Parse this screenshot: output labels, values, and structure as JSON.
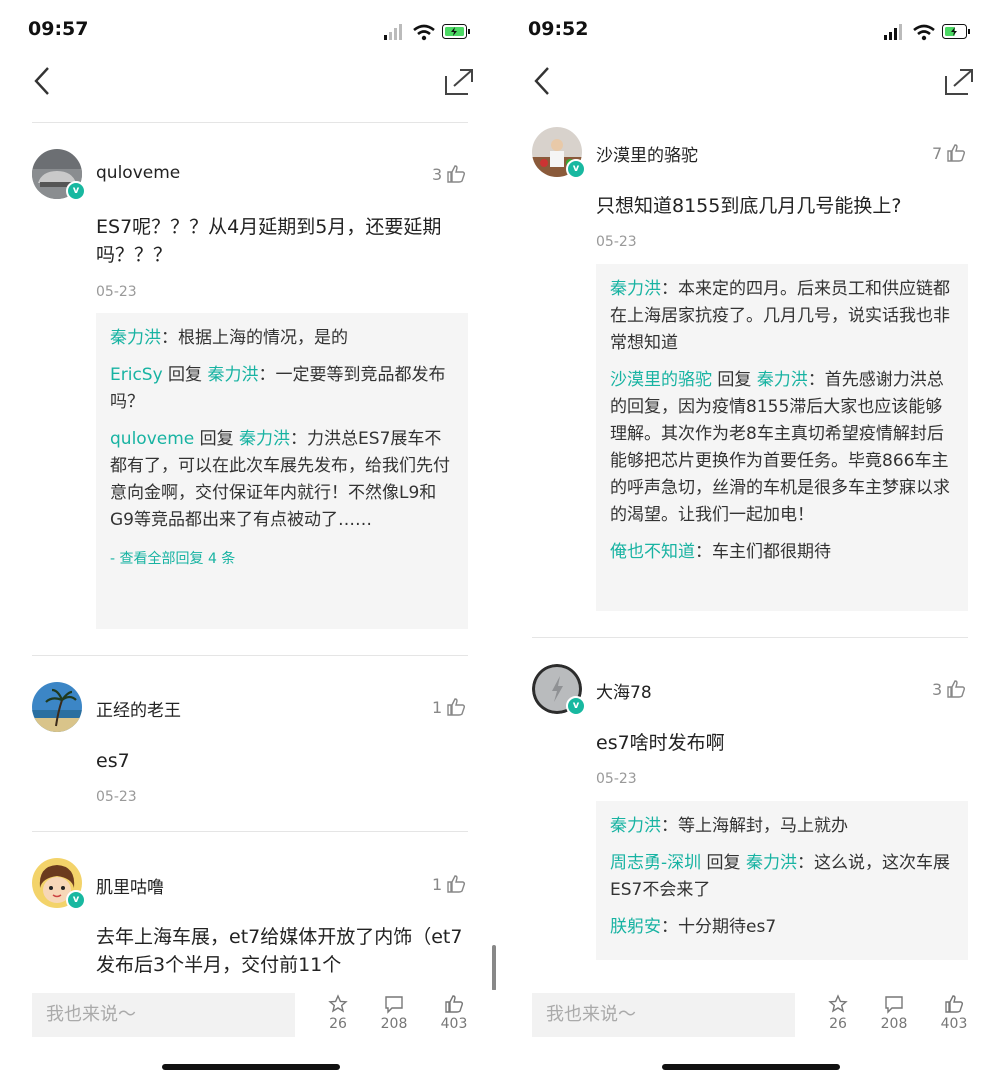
{
  "left": {
    "time": "09:57",
    "comments": [
      {
        "user": "quloveme",
        "likes": "3",
        "text": "ES7呢？？？从4月延期到5月，还要延期吗？？？",
        "date": "05-23",
        "replies": [
          {
            "name": "秦力洪",
            "reply_to": "",
            "text": "：根据上海的情况，是的"
          },
          {
            "name": "EricSy",
            "mid": " 回复 ",
            "reply_to": "秦力洪",
            "text": "：一定要等到竞品都发布吗？"
          },
          {
            "name": "quloveme",
            "mid": " 回复 ",
            "reply_to": "秦力洪",
            "text": "：力洪总ES7展车不都有了，可以在此次车展先发布，给我们先付意向金啊，交付保证年内就行！不然像L9和G9等竞品都出来了有点被动了……"
          }
        ],
        "more": "- 查看全部回复 4 条"
      },
      {
        "user": "正经的老王",
        "likes": "1",
        "text": "es7",
        "date": "05-23"
      },
      {
        "user": "肌里咕噜",
        "likes": "1",
        "text": "去年上海车展，et7给媒体开放了内饰（et7发布后3个半月，交付前11个"
      }
    ],
    "bottom": {
      "placeholder": "我也来说～",
      "star": "26",
      "comment": "208",
      "like": "403"
    }
  },
  "right": {
    "time": "09:52",
    "comments": [
      {
        "user": "沙漠里的骆驼",
        "likes": "7",
        "text": "只想知道8155到底几月几号能换上?",
        "date": "05-23",
        "replies": [
          {
            "name": "秦力洪",
            "text": "：本来定的四月。后来员工和供应链都在上海居家抗疫了。几月几号，说实话我也非常想知道"
          },
          {
            "name": "沙漠里的骆驼",
            "mid": " 回复 ",
            "reply_to": "秦力洪",
            "text": "：首先感谢力洪总的回复，因为疫情8155滞后大家也应该能够理解。其次作为老8车主真切希望疫情解封后能够把芯片更换作为首要任务。毕竟866车主的呼声急切，丝滑的车机是很多车主梦寐以求的渴望。让我们一起加电！"
          },
          {
            "name": "俺也不知道",
            "text": "：车主们都很期待"
          }
        ]
      },
      {
        "user": "大海78",
        "likes": "3",
        "text": "es7啥时发布啊",
        "date": "05-23",
        "replies": [
          {
            "name": "秦力洪",
            "text": "：等上海解封，马上就办"
          },
          {
            "name": "周志勇-深圳",
            "mid": " 回复 ",
            "reply_to": "秦力洪",
            "text": "：这么说，这次车展ES7不会来了"
          },
          {
            "name": "朕躬安",
            "text": "：十分期待es7"
          }
        ]
      }
    ],
    "bottom": {
      "placeholder": "我也来说～",
      "star": "26",
      "comment": "208",
      "like": "403"
    }
  },
  "colors": {
    "accent": "#18b3a2",
    "badge": "#18b8a0",
    "battery": "#4cd964"
  }
}
